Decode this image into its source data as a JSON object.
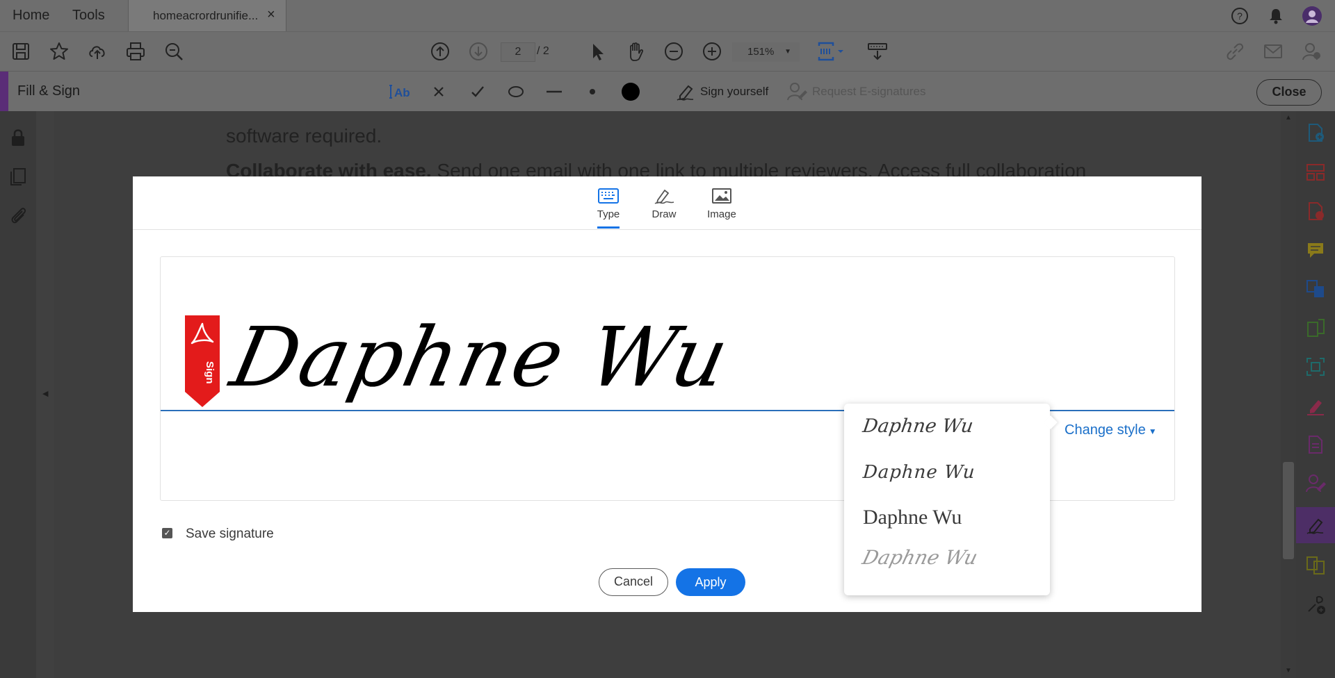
{
  "tabbar": {
    "home_label": "Home",
    "tools_label": "Tools",
    "doc_tab_title": "homeacrordrunifie...",
    "close_glyph": "×"
  },
  "toolbar": {
    "current_page": "2",
    "page_total": "/ 2",
    "zoom": "151%"
  },
  "fill_sign": {
    "title": "Fill & Sign",
    "sign_yourself": "Sign yourself",
    "request_esignatures": "Request E-signatures",
    "close_label": "Close",
    "accent_color": "#5a2d77"
  },
  "document": {
    "line1": "software required.",
    "line2_bold": "Collaborate with ease.",
    "line2_rest": " Send one email with one link to multiple reviewers. Access full collaboration"
  },
  "dialog": {
    "tabs": [
      {
        "label": "Type",
        "icon": "keyboard-icon",
        "active": true
      },
      {
        "label": "Draw",
        "icon": "pen-icon",
        "active": false
      },
      {
        "label": "Image",
        "icon": "image-icon",
        "active": false
      }
    ],
    "signature_text": "Daphne Wu",
    "sign_tag_text": "Sign",
    "change_style_label": "Change style",
    "save_signature_label": "Save signature",
    "save_signature_checked": true,
    "cancel_label": "Cancel",
    "apply_label": "Apply",
    "accent_color": "#1473e6"
  },
  "style_menu": {
    "options": [
      "Daphne Wu",
      "Daphne Wu",
      "Daphne Wu",
      "Daphne Wu"
    ]
  }
}
